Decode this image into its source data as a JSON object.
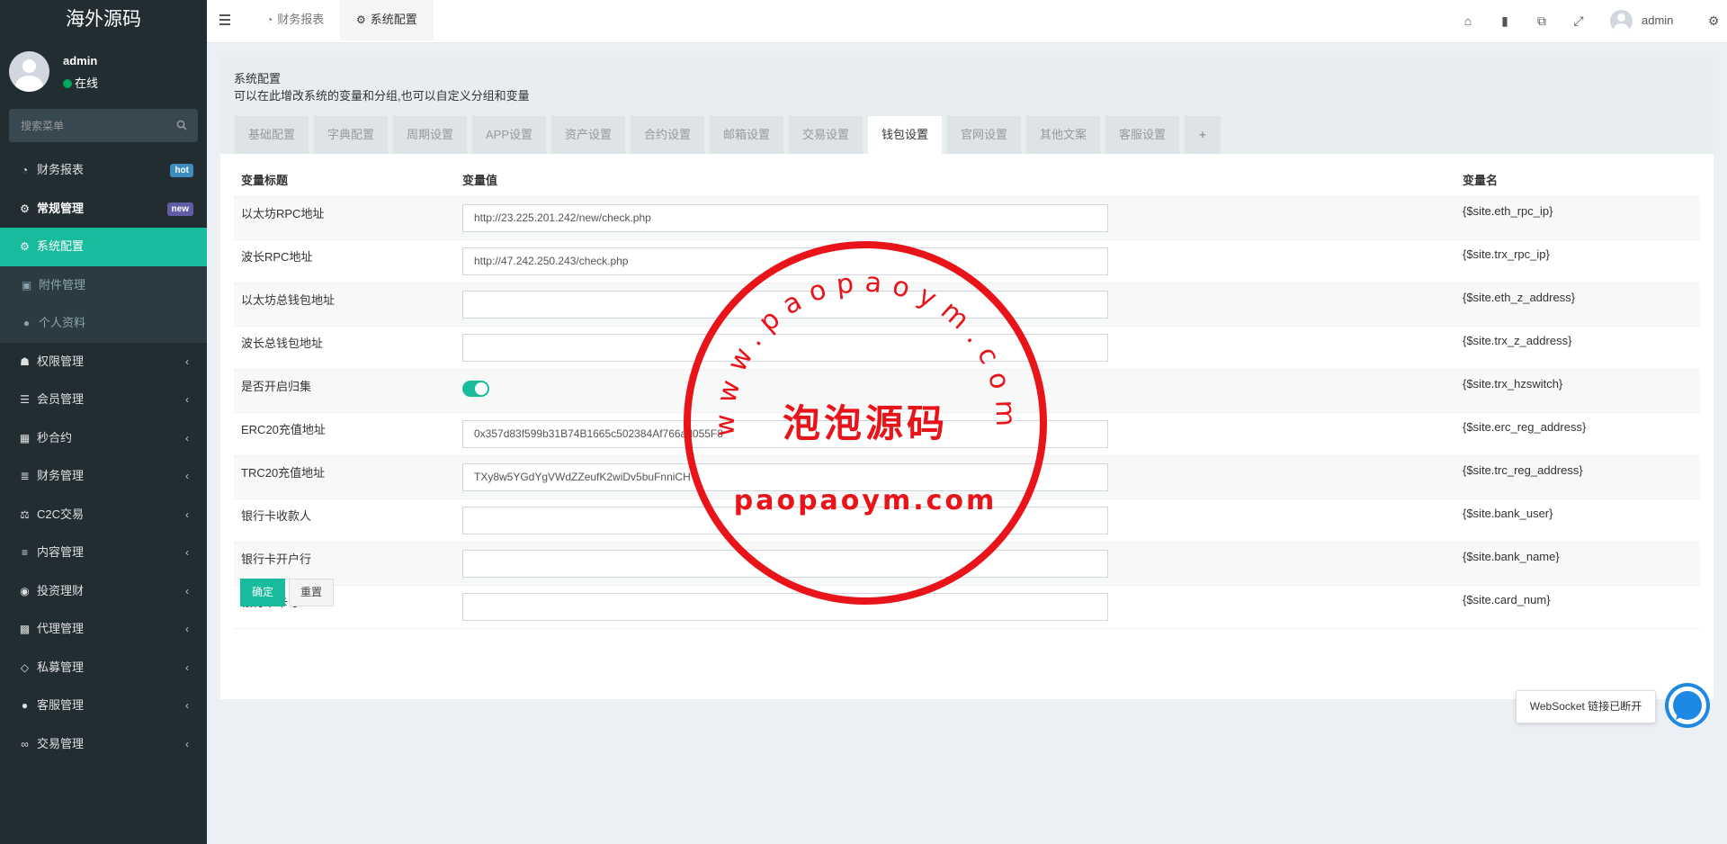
{
  "sidebar": {
    "logo": "海外源码",
    "user": {
      "name": "admin",
      "status": "在线"
    },
    "search_placeholder": "搜索菜单",
    "menu": [
      {
        "label": "财务报表",
        "icon": "dashboard-icon",
        "badge": "hot"
      },
      {
        "label": "常规管理",
        "icon": "cogs-icon",
        "badge": "new"
      },
      {
        "label": "系统配置",
        "icon": "gear-icon",
        "active": true
      },
      {
        "label": "附件管理",
        "icon": "file-image-icon"
      },
      {
        "label": "个人资料",
        "icon": "user-icon"
      },
      {
        "label": "权限管理",
        "icon": "group-icon"
      },
      {
        "label": "会员管理",
        "icon": "list-icon"
      },
      {
        "label": "秒合约",
        "icon": "calendar-icon"
      },
      {
        "label": "财务管理",
        "icon": "database-icon"
      },
      {
        "label": "C2C交易",
        "icon": "balance-scale-icon"
      },
      {
        "label": "内容管理",
        "icon": "align-left-icon"
      },
      {
        "label": "投资理财",
        "icon": "compass-icon"
      },
      {
        "label": "代理管理",
        "icon": "briefcase-icon"
      },
      {
        "label": "私募管理",
        "icon": "diamond-icon"
      },
      {
        "label": "客服管理",
        "icon": "comment-icon"
      },
      {
        "label": "交易管理",
        "icon": "handshake-icon"
      }
    ]
  },
  "header": {
    "tabs": [
      {
        "label": "财务报表",
        "icon": "dashboard-icon"
      },
      {
        "label": "系统配置",
        "icon": "gear-icon",
        "active": true
      }
    ],
    "icons": [
      "home-icon",
      "trash-icon",
      "translate-icon",
      "fullscreen-icon",
      "cogs-icon"
    ],
    "user": "admin"
  },
  "panel": {
    "title": "系统配置",
    "description": "可以在此增改系统的变量和分组,也可以自定义分组和变量",
    "tabs": [
      "基础配置",
      "字典配置",
      "周期设置",
      "APP设置",
      "资产设置",
      "合约设置",
      "邮箱设置",
      "交易设置",
      "钱包设置",
      "官网设置",
      "其他文案",
      "客服设置",
      "+"
    ],
    "active_tab": "钱包设置",
    "columns": {
      "title": "变量标题",
      "value": "变量值",
      "name": "变量名"
    },
    "rows": [
      {
        "title": "以太坊RPC地址",
        "value": "http://23.225.201.242/new/check.php",
        "name": "{$site.eth_rpc_ip}"
      },
      {
        "title": "波长RPC地址",
        "value": "http://47.242.250.243/check.php",
        "name": "{$site.trx_rpc_ip}"
      },
      {
        "title": "以太坊总钱包地址",
        "value": "",
        "name": "{$site.eth_z_address}"
      },
      {
        "title": "波长总钱包地址",
        "value": "",
        "name": "{$site.trx_z_address}"
      },
      {
        "title": "是否开启归集",
        "value": "on",
        "type": "switch",
        "name": "{$site.trx_hzswitch}"
      },
      {
        "title": "ERC20充值地址",
        "value": "0x357d83f599b31B74B1665c502384Af766ad055F8",
        "name": "{$site.erc_reg_address}"
      },
      {
        "title": "TRC20充值地址",
        "value": "TXy8w5YGdYgVWdZZeufK2wiDv5buFnniCH",
        "name": "{$site.trc_reg_address}"
      },
      {
        "title": "银行卡收款人",
        "value": "",
        "name": "{$site.bank_user}"
      },
      {
        "title": "银行卡开户行",
        "value": "",
        "name": "{$site.bank_name}"
      },
      {
        "title": "银行卡卡号",
        "value": "",
        "name": "{$site.card_num}"
      }
    ],
    "buttons": {
      "ok": "确定",
      "reset": "重置"
    }
  },
  "watermark": {
    "arc_text": "www.paopaoym.com",
    "center_text": "泡泡源码",
    "bottom_text": "paopaoym.com",
    "color": "#e8141a"
  },
  "websocket": {
    "tip": "WebSocket 链接已断开"
  },
  "colors": {
    "accent": "#18bc9c",
    "sidebar": "#222d32",
    "hot": "#3c8dbc",
    "new": "#605ca8"
  }
}
